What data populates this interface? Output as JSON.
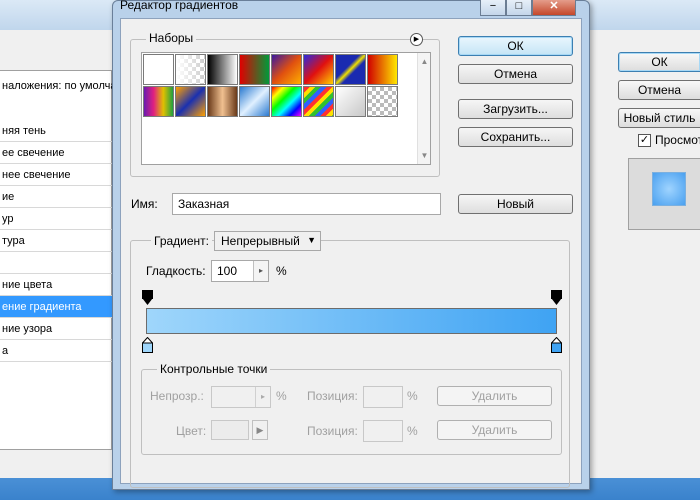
{
  "layer_style": {
    "blend_label": "наложения: по умолча",
    "list_items": [
      "няя тень",
      "ее свечение",
      "нее свечение",
      "ие",
      "ур",
      "тура",
      "",
      "ние цвета",
      "ение градиента",
      "ние узора",
      "а"
    ],
    "selected_index": 8,
    "buttons": {
      "ok": "ОК",
      "cancel": "Отмена",
      "new_style": "Новый стиль"
    },
    "preview_label": "Просмотр",
    "preview_checked": true
  },
  "gradient_editor": {
    "title": "Редактор градиентов",
    "window_buttons": {
      "minimize": "−",
      "maximize": "□",
      "close": "✕"
    },
    "presets_label": "Наборы",
    "presets_menu_icon": "arrow-circle-icon",
    "buttons": {
      "ok": "ОК",
      "cancel": "Отмена",
      "load": "Загрузить...",
      "save": "Сохранить...",
      "new": "Новый"
    },
    "name_label": "Имя:",
    "name_value": "Заказная",
    "gradient_type_label": "Градиент:",
    "gradient_type_value": "Непрерывный",
    "smoothness_label": "Гладкость:",
    "smoothness_value": "100",
    "smoothness_unit": "%",
    "gradient_colors": {
      "start": "#9fd6fb",
      "end": "#3fa3f3"
    },
    "stops_group_label": "Контрольные точки",
    "opacity_label": "Непрозр.:",
    "opacity_unit": "%",
    "position_label": "Позиция:",
    "position_unit": "%",
    "color_label": "Цвет:",
    "delete_label": "Удалить"
  }
}
